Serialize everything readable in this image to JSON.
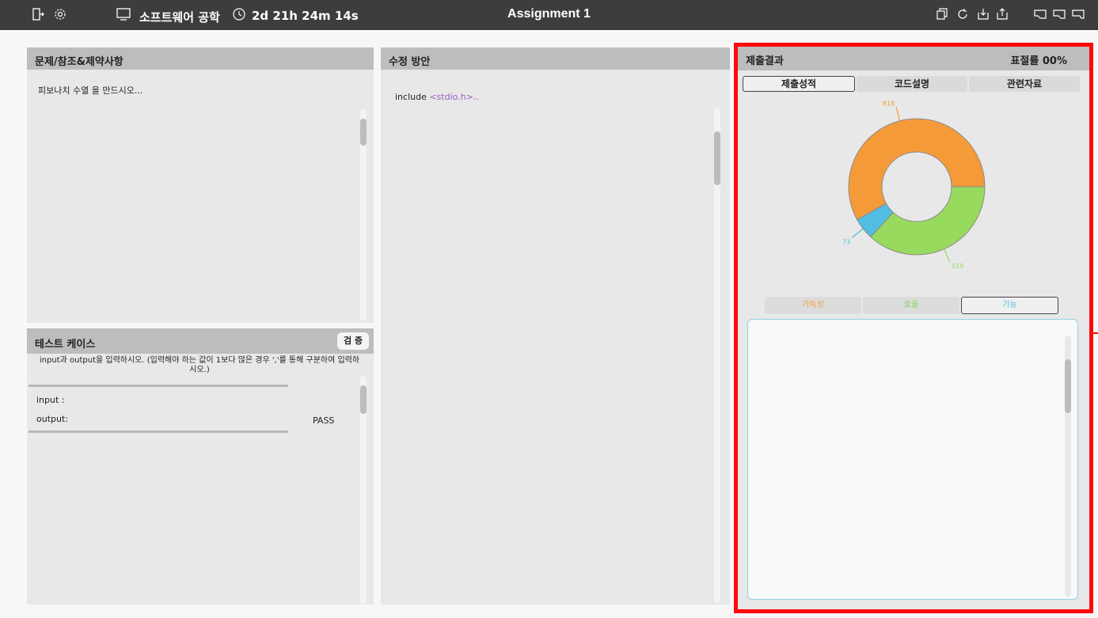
{
  "topbar": {
    "course": "소프트웨어 공학",
    "timer": "2d 21h 24m 14s",
    "title": "Assignment 1"
  },
  "problem": {
    "header": "문제/참조&제약사항",
    "text": "피보나치 수열 을 만드시오..."
  },
  "fix": {
    "header": "수정 방안",
    "code_plain": "include ",
    "code_highlight": "<stdio.h>..",
    "highlight_color": "#9a5cc6"
  },
  "testcase": {
    "header": "테스트 케이스",
    "verify_label": "검 증",
    "instruction": "input과 output을 입력하시오. (입력해야 하는 값이 1보다 많은 경우 ','를 통해 구분하여 입력하시오.)",
    "input_label": "input :",
    "output_label": "output:",
    "result": "PASS"
  },
  "result": {
    "header": "제출결과",
    "plagiarism": "표절률 00%",
    "tabs": [
      "제출성적",
      "코드설명",
      "관련자료"
    ],
    "active_tab": 0,
    "legend": [
      {
        "label": "가독성",
        "color": "#f59a38"
      },
      {
        "label": "효율",
        "color": "#8fd05c"
      },
      {
        "label": "기능",
        "color": "#52bde3"
      }
    ],
    "active_legend": 2
  },
  "chart_data": {
    "type": "pie",
    "labels": [
      "818",
      "519",
      "73"
    ],
    "values": [
      818,
      519,
      73
    ],
    "colors": [
      "#f59a38",
      "#98da5e",
      "#52bde3"
    ]
  }
}
